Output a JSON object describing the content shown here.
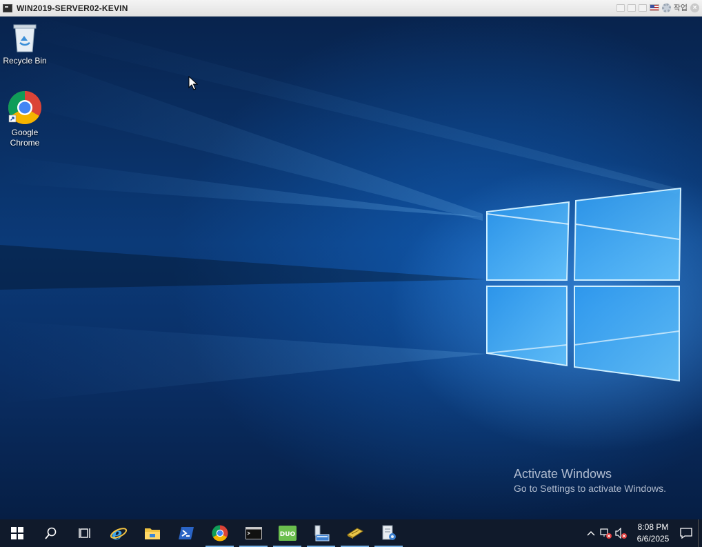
{
  "window": {
    "title": "WIN2019-SERVER02-KEVIN",
    "work_label": "작업"
  },
  "desktop": {
    "icons": [
      {
        "label": "Recycle Bin"
      },
      {
        "label": "Google\nChrome"
      }
    ],
    "watermark": {
      "line1": "Activate Windows",
      "line2": "Go to Settings to activate Windows."
    }
  },
  "taskbar": {
    "apps": [
      "start-icon",
      "search-icon",
      "task-view-icon",
      "internet-explorer-icon",
      "file-explorer-icon",
      "powershell-icon",
      "chrome-icon",
      "command-prompt-icon",
      "duo-icon",
      "server-manager-icon",
      "yellow-tool-icon",
      "settings-doc-icon"
    ],
    "time": "8:08 PM",
    "date": "6/6/2025"
  }
}
